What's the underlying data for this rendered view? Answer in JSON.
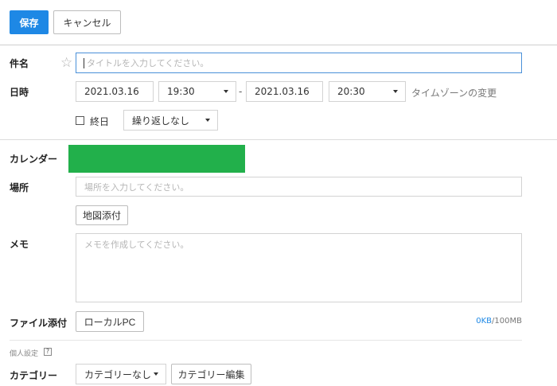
{
  "toolbar": {
    "save_label": "保存",
    "cancel_label": "キャンセル"
  },
  "subject": {
    "label": "件名",
    "star": "☆",
    "placeholder": "タイトルを入力してください。"
  },
  "datetime": {
    "label": "日時",
    "start_date": "2021.03.16",
    "start_time": "19:30",
    "separator": "-",
    "end_date": "2021.03.16",
    "end_time": "20:30",
    "timezone_link": "タイムゾーンの変更",
    "all_day_label": "終日",
    "all_day_checked": false,
    "repeat": "繰り返しなし"
  },
  "calendar": {
    "label": "カレンダー",
    "color": "#22b04b"
  },
  "place": {
    "label": "場所",
    "placeholder": "場所を入力してください。",
    "map_button": "地図添付"
  },
  "memo": {
    "label": "メモ",
    "placeholder": "メモを作成してください。"
  },
  "attachment": {
    "label": "ファイル添付",
    "button": "ローカルPC",
    "used": "0KB",
    "limit": "/100MB"
  },
  "personal": {
    "title": "個人設定",
    "help": "?"
  },
  "category": {
    "label": "カテゴリー",
    "value": "カテゴリーなし",
    "edit_button": "カテゴリー編集"
  }
}
